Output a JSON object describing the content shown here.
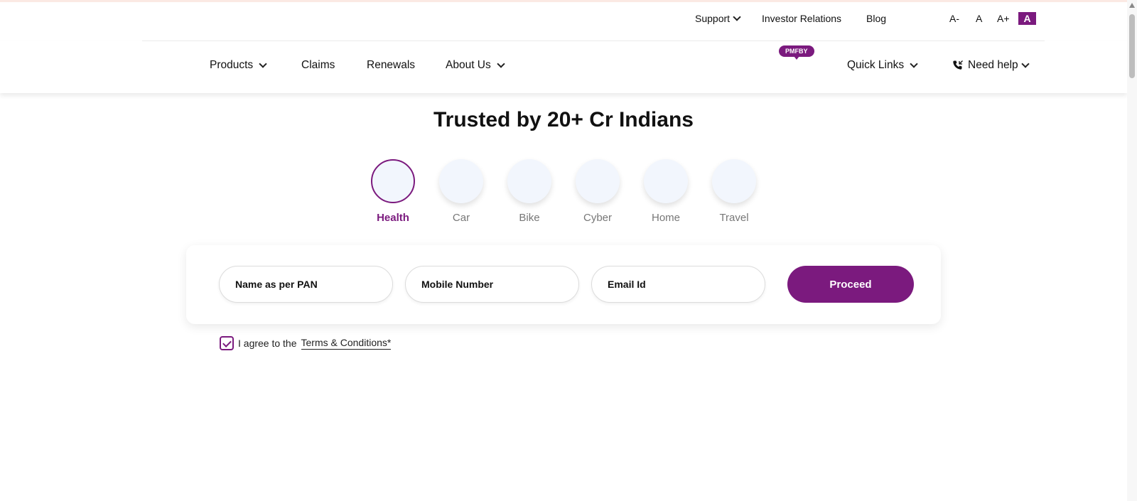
{
  "utility_bar": {
    "support": "Support",
    "investor_relations": "Investor Relations",
    "blog": "Blog",
    "font_decrease": "A-",
    "font_normal": "A",
    "font_increase": "A+",
    "font_active": "A"
  },
  "nav": {
    "products": "Products",
    "claims": "Claims",
    "renewals": "Renewals",
    "about_us": "About Us",
    "badge": "PMFBY",
    "quick_links": "Quick Links",
    "need_help": "Need help"
  },
  "hero": {
    "title": "Trusted by 20+ Cr Indians"
  },
  "products": [
    {
      "label": "Health",
      "active": true
    },
    {
      "label": "Car"
    },
    {
      "label": "Bike"
    },
    {
      "label": "Cyber"
    },
    {
      "label": "Home"
    },
    {
      "label": "Travel"
    }
  ],
  "form": {
    "name_placeholder": "Name as per PAN",
    "mobile_placeholder": "Mobile Number",
    "email_placeholder": "Email Id",
    "proceed_label": "Proceed"
  },
  "agreement": {
    "prefix": "I agree to the",
    "link": "Terms & Conditions*",
    "checked": true
  },
  "colors": {
    "brand": "#7b1a7e",
    "circle_bg": "#f2f6fd"
  }
}
